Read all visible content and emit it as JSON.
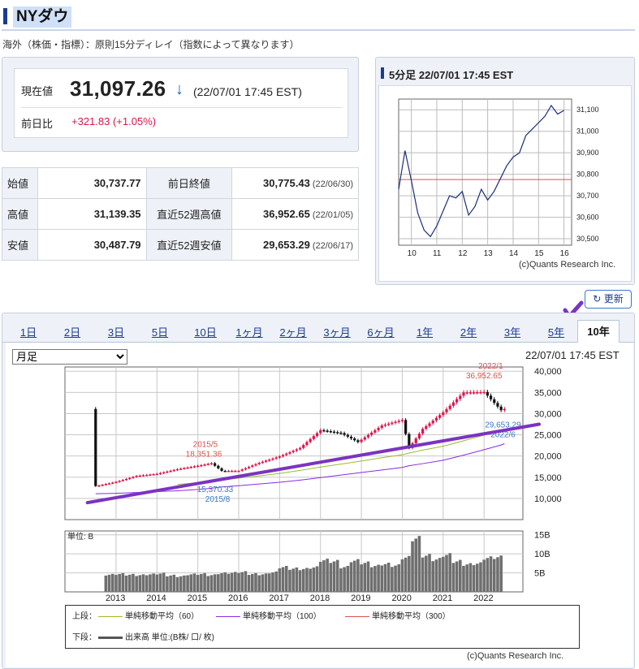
{
  "header": {
    "title": "NYダウ",
    "note": "海外（株価・指標）：原則15分ディレイ（指数によって異なります）"
  },
  "quote": {
    "current_label": "現在値",
    "price": "31,097.26",
    "arrow": "↓",
    "timestamp": "(22/07/01 17:45 EST)",
    "prev_diff_label": "前日比",
    "change": "+321.83 (+1.05%)"
  },
  "stats": {
    "open_label": "始値",
    "open": "30,737.77",
    "high_label": "高値",
    "high": "31,139.35",
    "low_label": "安値",
    "low": "30,487.79",
    "prev_close_label": "前日終値",
    "prev_close": "30,775.43",
    "prev_close_date": "(22/06/30)",
    "w52_high_label": "直近52週高値",
    "w52_high": "36,952.65",
    "w52_high_date": "(22/01/05)",
    "w52_low_label": "直近52週安値",
    "w52_low": "29,653.29",
    "w52_low_date": "(22/06/17)"
  },
  "intraday": {
    "title": "5分足 22/07/01 17:45 EST",
    "copyright": "(c)Quants Research Inc.",
    "colors": {
      "line": "#1a2f7a",
      "ref_line": "#d9534f"
    }
  },
  "refresh_label": "更新",
  "tabs": [
    {
      "label": "1日"
    },
    {
      "label": "2日"
    },
    {
      "label": "3日"
    },
    {
      "label": "5日"
    },
    {
      "label": "10日"
    },
    {
      "label": "1ヶ月"
    },
    {
      "label": "2ヶ月"
    },
    {
      "label": "3ヶ月"
    },
    {
      "label": "6ヶ月"
    },
    {
      "label": "1年"
    },
    {
      "label": "2年"
    },
    {
      "label": "3年"
    },
    {
      "label": "5年"
    },
    {
      "label": "10年"
    }
  ],
  "active_tab": "10年",
  "chart_controls": {
    "period_select": "月足",
    "period_options": [
      "月足"
    ],
    "timestamp": "22/07/01 17:45 EST"
  },
  "annotations": {
    "high_2015": [
      "2015/5",
      "18,351.36"
    ],
    "low_2015": [
      "15,370.33",
      "2015/8"
    ],
    "high_2022": [
      "2022/1",
      "36,952.65"
    ],
    "low_2022": [
      "29,653.29",
      "2022/6"
    ]
  },
  "legend": {
    "upper_label": "上段：",
    "ma60": "単純移動平均（60）",
    "ma100": "単純移動平均（100）",
    "ma300": "単純移動平均（300）",
    "lower_label": "下段：",
    "volume": "出来高 単位:(B株/ 口/ 枚)"
  },
  "volume_unit": "単位: B",
  "copyright": "(c)Quants Research Inc.",
  "colors": {
    "up_candle": "#e0134a",
    "down_candle": "#111111",
    "ma60": "#9bbd2a",
    "ma100": "#8a2be2",
    "ma300": "#d9534f",
    "annotation_red": "#d9534f",
    "annotation_blue": "#3a78c9",
    "volume_bar": "#6f6f6f",
    "trendline": "#7b33c2"
  },
  "chart_data": [
    {
      "type": "line",
      "title": "5分足 22/07/01 17:45 EST",
      "x": [
        9.5,
        9.75,
        10.0,
        10.25,
        10.5,
        10.75,
        11.0,
        11.25,
        11.5,
        11.75,
        12.0,
        12.25,
        12.5,
        12.75,
        13.0,
        13.25,
        13.5,
        13.75,
        14.0,
        14.25,
        14.5,
        14.75,
        15.0,
        15.25,
        15.5,
        15.75,
        16.0
      ],
      "series": [
        {
          "values": [
            30730,
            30910,
            30770,
            30620,
            30540,
            30510,
            30560,
            30630,
            30700,
            30690,
            30720,
            30610,
            30650,
            30730,
            30680,
            30720,
            30780,
            30840,
            30880,
            30900,
            30980,
            31010,
            31040,
            31070,
            31120,
            31080,
            31097
          ]
        }
      ],
      "reference_line": 30775.43,
      "xticks": [
        10,
        11,
        12,
        13,
        14,
        15,
        16
      ],
      "yticks": [
        "30,500",
        "30,600",
        "30,700",
        "30,800",
        "30,900",
        "31,000",
        "31,100"
      ],
      "ylim": [
        30470,
        31150
      ],
      "grid": true
    },
    {
      "type": "line",
      "title": "",
      "x": [
        "2012/07",
        "2013/01",
        "2013/07",
        "2014/01",
        "2014/07",
        "2015/01",
        "2015/05",
        "2015/08",
        "2016/01",
        "2016/07",
        "2017/01",
        "2017/07",
        "2018/01",
        "2018/07",
        "2018/12",
        "2019/07",
        "2020/01",
        "2020/03",
        "2020/07",
        "2021/01",
        "2021/07",
        "2022/01",
        "2022/06",
        "2022/07"
      ],
      "series": [
        {
          "name": "NYダウ",
          "values": [
            12900,
            13900,
            15300,
            15800,
            16900,
            17700,
            18300,
            16500,
            16500,
            18400,
            19900,
            21900,
            26100,
            25400,
            23300,
            27200,
            28500,
            21900,
            26400,
            30300,
            35000,
            35100,
            30800,
            31097
          ]
        },
        {
          "name": "単純移動平均（60）",
          "values": [
            null,
            null,
            null,
            null,
            13300,
            13700,
            14100,
            14400,
            14800,
            15300,
            15900,
            16600,
            17400,
            18100,
            18700,
            19600,
            20300,
            20700,
            21400,
            22300,
            23600,
            24900,
            25900,
            26200
          ]
        },
        {
          "name": "単純移動平均（100）",
          "values": [
            11100,
            11200,
            11400,
            11600,
            11800,
            12100,
            12400,
            12700,
            13000,
            13400,
            13800,
            14300,
            14900,
            15500,
            16000,
            16700,
            17300,
            17700,
            18200,
            19000,
            20200,
            21500,
            22600,
            22900
          ]
        }
      ],
      "annotations": [
        {
          "label": "2015/5 18,351.36",
          "value": 18351.36
        },
        {
          "label": "15,370.33 2015/8",
          "value": 15370.33
        },
        {
          "label": "2022/1 36,952.65",
          "value": 36952.65
        },
        {
          "label": "29,653.29 2022/6",
          "value": 29653.29
        }
      ],
      "xticks": [
        "2013",
        "2014",
        "2015",
        "2016",
        "2017",
        "2018",
        "2019",
        "2020",
        "2021",
        "2022"
      ],
      "yticks": [
        "10,000",
        "15,000",
        "20,000",
        "25,000",
        "30,000",
        "35,000",
        "40,000"
      ],
      "ylim": [
        5000,
        41000
      ],
      "grid": true
    },
    {
      "type": "bar",
      "title": "",
      "ylabel": "単位: B",
      "categories": [
        "2012/10",
        "2013/01",
        "2013/04",
        "2013/07",
        "2013/10",
        "2014/01",
        "2014/04",
        "2014/07",
        "2014/10",
        "2015/01",
        "2015/04",
        "2015/07",
        "2015/10",
        "2016/01",
        "2016/04",
        "2016/07",
        "2016/10",
        "2017/01",
        "2017/04",
        "2017/07",
        "2017/10",
        "2018/01",
        "2018/04",
        "2018/07",
        "2018/10",
        "2019/01",
        "2019/04",
        "2019/07",
        "2019/10",
        "2020/01",
        "2020/04",
        "2020/07",
        "2020/10",
        "2021/01",
        "2021/04",
        "2021/07",
        "2021/10",
        "2022/01",
        "2022/04"
      ],
      "values": [
        4.5,
        4.7,
        4.5,
        4.4,
        4.6,
        4.8,
        4.3,
        4.1,
        4.6,
        4.7,
        4.4,
        4.9,
        5.0,
        5.2,
        4.7,
        4.6,
        5.1,
        6.5,
        6.1,
        6.0,
        6.4,
        8.3,
        8.0,
        6.5,
        8.2,
        7.6,
        6.8,
        7.3,
        6.9,
        9.0,
        14.0,
        9.5,
        8.5,
        9.7,
        8.0,
        7.2,
        7.4,
        8.9,
        9.1
      ],
      "yticks": [
        "5B",
        "10B",
        "15B"
      ],
      "ylim": [
        0,
        16
      ]
    }
  ]
}
